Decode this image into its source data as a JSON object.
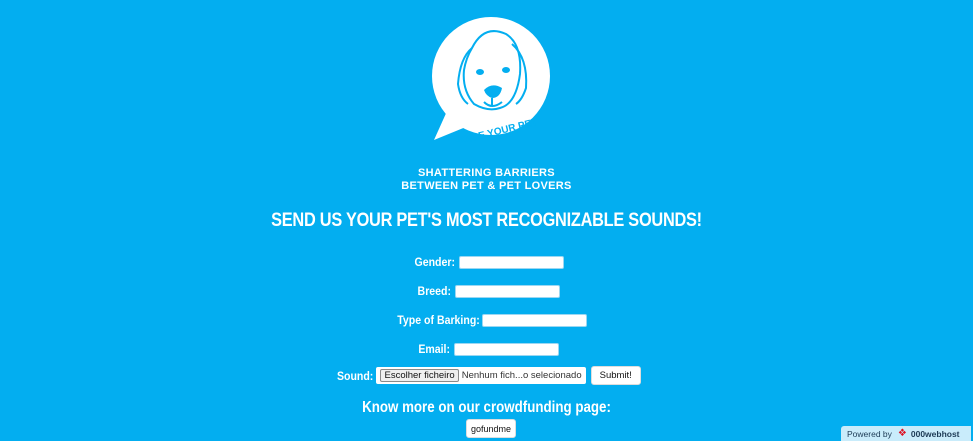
{
  "brand": {
    "logo_text": "VOICE YOUR PET",
    "tagline_line1": "SHATTERING BARRIERS",
    "tagline_line2": "BETWEEN PET & PET LOVERS"
  },
  "headline": "SEND US YOUR PET'S MOST RECOGNIZABLE SOUNDS!",
  "form": {
    "gender_label": "Gender:",
    "gender_value": "",
    "breed_label": "Breed:",
    "breed_value": "",
    "barking_label": "Type of Barking:",
    "barking_value": "",
    "email_label": "Email:",
    "email_value": "",
    "sound_label": "Sound:",
    "file_button_label": "Escolher ficheiro",
    "file_status": "Nenhum fich...o selecionado",
    "submit_label": "Submit!"
  },
  "crowdfunding": {
    "heading": "Know more on our crowdfunding page:",
    "button_label": "gofundme"
  },
  "footer": {
    "powered_by": "Powered by",
    "host_name": "000webhost"
  },
  "colors": {
    "background": "#03aef0",
    "text": "#ffffff"
  }
}
